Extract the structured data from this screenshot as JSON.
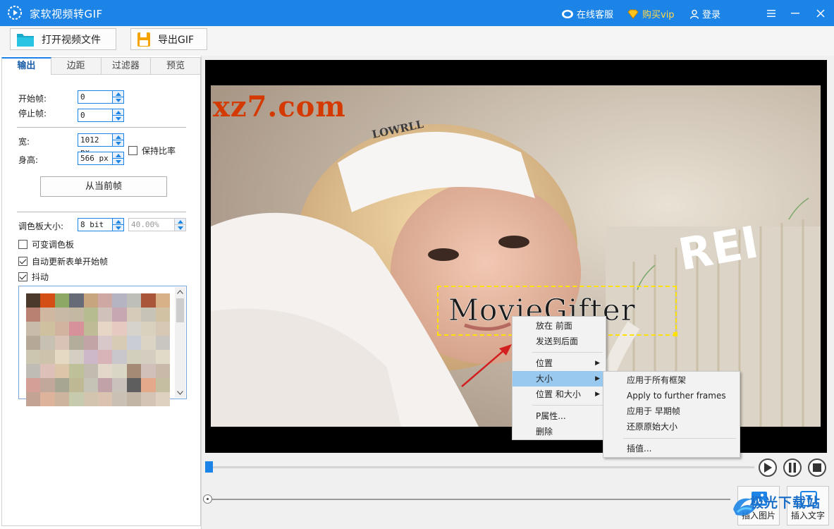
{
  "titlebar": {
    "title": "家软视频转GIF",
    "service": "在线客服",
    "buy_vip": "购买vip",
    "login": "登录",
    "accent": "#1c84e6"
  },
  "toolbar": {
    "open_video": "打开视频文件",
    "export_gif": "导出GIF"
  },
  "tabs": [
    "输出",
    "边距",
    "过滤器",
    "预览"
  ],
  "output": {
    "start_frame_label": "开始帧:",
    "start_frame_value": "0",
    "stop_frame_label": "停止帧:",
    "stop_frame_value": "0",
    "width_label": "宽:",
    "width_value": "1012 px",
    "height_label": "身高:",
    "height_value": "566 px",
    "keep_ratio_label": "保持比率",
    "keep_ratio_checked": false,
    "from_current_frame": "从当前帧",
    "palette_size_label": "调色板大小:",
    "palette_size_value": "8 bit",
    "palette_percent": "40.00%",
    "variable_palette": {
      "label": "可变调色板",
      "checked": false
    },
    "auto_update": {
      "label": "自动更新表单开始帧",
      "checked": true
    },
    "dither": {
      "label": "抖动",
      "checked": true
    },
    "palette_colors": [
      "#4b3a2c",
      "#d44f16",
      "#8da865",
      "#676b78",
      "#c7a57e",
      "#cfa8a4",
      "#b5b4c2",
      "#bfbfb9",
      "#a8553a",
      "#d9b189",
      "#b98172",
      "#d0b7a1",
      "#c8b9a7",
      "#c5b8a3",
      "#b7bc90",
      "#d0c1ba",
      "#c7a7b2",
      "#d6cab9",
      "#c7c3b6",
      "#d1c2a3",
      "#c9bbaa",
      "#cfc19f",
      "#d1b3a0",
      "#d6919b",
      "#bfbb97",
      "#e7d6c5",
      "#e6c9c0",
      "#d6d3cd",
      "#d9d0be",
      "#d7c7b5",
      "#b5a896",
      "#c7c1b4",
      "#d8c3b6",
      "#b3ae9b",
      "#c2a3a6",
      "#d8c8c9",
      "#d7cbb6",
      "#cacdd5",
      "#dbd3c3",
      "#c9c5c0",
      "#ccc6b0",
      "#ccc3aa",
      "#e6d9c1",
      "#d4cfc2",
      "#ccb8c8",
      "#d8b4b8",
      "#c9c7cb",
      "#d3cfbd",
      "#d3cec0",
      "#e1dac8",
      "#bebcb5",
      "#ddc0b8",
      "#dcc6aa",
      "#bec09a",
      "#c2bbb0",
      "#e2d7c8",
      "#dad6c5",
      "#a58a76",
      "#d1c0b9",
      "#c9b9a8",
      "#d4a095",
      "#c1a89a",
      "#a7a693",
      "#bfb894",
      "#c4c3b5",
      "#c1a2a8",
      "#c9c2ba",
      "#5f5e5e",
      "#e4a98a",
      "#c5bea1",
      "#c3a494",
      "#ddb39c",
      "#ccb49f",
      "#c6cbae",
      "#d3c5ad",
      "#dac4b1",
      "#cac0b4",
      "#c2b5a6",
      "#d3c4b5",
      "#dfd1c0"
    ]
  },
  "overlay": {
    "watermark": "xz7.com",
    "caption": "MovieGifter"
  },
  "context_menu": {
    "bring_front": "放在 前面",
    "send_back": "发送到后面",
    "position": "位置",
    "size": "大小",
    "pos_size": "位置 和大小",
    "properties": "P属性...",
    "delete": "删除"
  },
  "submenu": {
    "apply_all": "应用于所有框架",
    "apply_further": "Apply to further frames",
    "apply_earlier": "应用于 早期帧",
    "restore_size": "还原原始大小",
    "interpolate": "插值..."
  },
  "bottom": {
    "insert_image": "插入图片",
    "insert_text": "插入文字",
    "corner_brand": "极光下载站"
  }
}
